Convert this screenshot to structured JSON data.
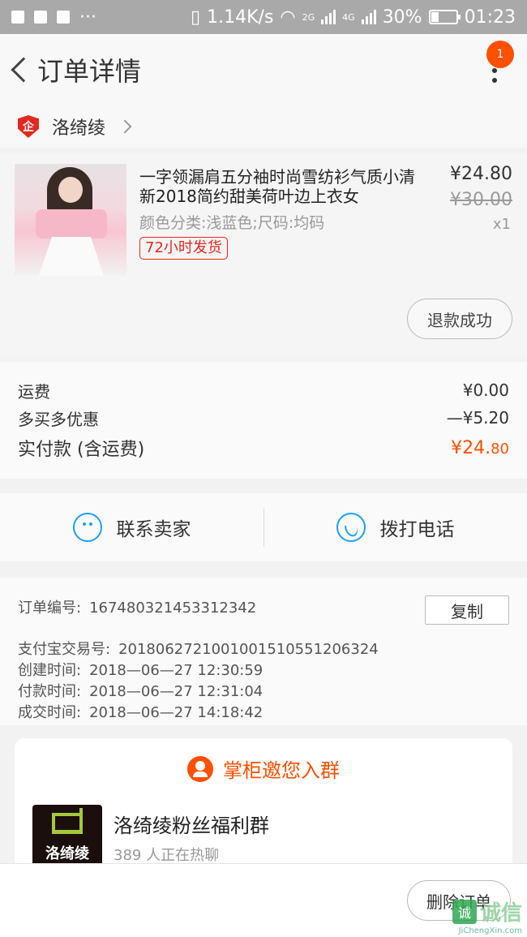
{
  "status_bar": {
    "speed": "1.14K/s",
    "net_2g": "2G",
    "net_4g": "4G",
    "battery": "30%",
    "time": "01:23"
  },
  "header": {
    "title": "订单详情",
    "badge_count": "1"
  },
  "shop": {
    "icon_text": "企",
    "name": "洛绮绫"
  },
  "product": {
    "title": "一字领漏肩五分袖时尚雪纺衫气质小清新2018简约甜美荷叶边上衣女",
    "sku": "颜色分类:浅蓝色;尺码:均码",
    "tag": "72小时发货",
    "price": "¥24.80",
    "original_price": "¥30.00",
    "quantity": "x1",
    "refund_label": "退款成功"
  },
  "fees": {
    "shipping_label": "运费",
    "shipping_value": "¥0.00",
    "discount_label": "多买多优惠",
    "discount_value": "—¥5.20",
    "total_label": "实付款 (含运费)",
    "total_value_main": "¥24.",
    "total_value_cents": "80"
  },
  "contact": {
    "seller_label": "联系卖家",
    "phone_label": "拨打电话"
  },
  "order_info": {
    "copy_label": "复制",
    "rows": [
      {
        "key": "订单编号:",
        "value": "167480321453312342"
      },
      {
        "key": "支付宝交易号:",
        "value": "2018062721001001510551206324"
      },
      {
        "key": "创建时间:",
        "value": "2018—06—27  12:30:59"
      },
      {
        "key": "付款时间:",
        "value": "2018—06—27  12:31:04"
      },
      {
        "key": "成交时间:",
        "value": "2018—06—27  14:18:42"
      }
    ]
  },
  "group": {
    "title": "掌柜邀您入群",
    "logo_text": "洛绮绫",
    "name": "洛绮绫粉丝福利群",
    "subtitle": "389 人正在热聊"
  },
  "bottom": {
    "delete_label": "删除订单",
    "watermark_char": "诚",
    "watermark_text": "诚信",
    "watermark_url": "JiChengXin.com"
  },
  "colors": {
    "accent": "#ff5000",
    "link_blue": "#1da1f2",
    "tag_red": "#e4281f"
  }
}
